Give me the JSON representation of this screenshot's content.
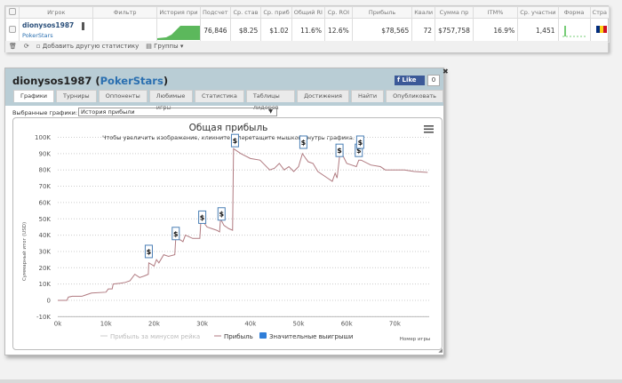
{
  "table": {
    "headers": [
      "Игрок",
      "Фильтр",
      "История при",
      "Подсчет",
      "Ср. став",
      "Ср. приб",
      "Общий RI",
      "Ср. ROI",
      "Прибыль",
      "Квали",
      "Сумма пр",
      "ITM%",
      "Ср. участни",
      "Форма",
      "Стра"
    ],
    "row": {
      "player": "dionysos1987",
      "site": "PokerStars",
      "count": "76,846",
      "avg_stake": "$8.25",
      "avg_profit": "$1.02",
      "total_roi": "11.6%",
      "avg_roi": "12.6%",
      "profit": "$78,565",
      "quali": "72",
      "sum": "$757,758",
      "itm": "16.9%",
      "avg_entrants": "1,451"
    },
    "toolbar": {
      "add_stat": "Добавить другую статистику",
      "groups": "Группы ▾"
    }
  },
  "popup": {
    "player": "dionysos1987",
    "site": "PokerStars",
    "like": "Like",
    "like_count": "0",
    "tabs": [
      "Графики",
      "Турниры",
      "Оппоненты",
      "Любимые игры",
      "Статистика",
      "Таблицы лидеров",
      "Достижения",
      "Найти",
      "Опубликовать"
    ],
    "selected_label": "Выбранные графики:",
    "selected_value": "История прибыли"
  },
  "chart_data": {
    "type": "line",
    "title": "Общая прибыль",
    "subtitle": "Чтобы увеличить изображение, кликните и перетащите мышкой внутрь графика.",
    "xlabel": "Номер игры",
    "ylabel": "Суммарный итог (USD)",
    "xlim": [
      0,
      78
    ],
    "ylim": [
      -10,
      100
    ],
    "xticks": [
      "0k",
      "10k",
      "20k",
      "30k",
      "40k",
      "50k",
      "60k",
      "70k"
    ],
    "yticks": [
      "-10K",
      "0",
      "10K",
      "20K",
      "30K",
      "40K",
      "50K",
      "60K",
      "70K",
      "80K",
      "90K",
      "100K"
    ],
    "legend": [
      "Прибыль за минусом рейка",
      "Прибыль",
      "Значительные выигрыши"
    ],
    "marker_label": "$",
    "series": [
      {
        "name": "Прибыль",
        "x_k": [
          0,
          1.9,
          2.2,
          3,
          5,
          5.5,
          7,
          10,
          10.5,
          11.3,
          11.5,
          13,
          14,
          15,
          16,
          17,
          18,
          18.8,
          18.9,
          19.5,
          20,
          20.5,
          21,
          22,
          23,
          24.3,
          24.5,
          25.5,
          26,
          26.5,
          28,
          29.5,
          29.7,
          30,
          31,
          33,
          33.6,
          33.8,
          34.5,
          35.5,
          36.3,
          36.5,
          38,
          40,
          42,
          43,
          44,
          45,
          46,
          47,
          48,
          49,
          50,
          50.8,
          51.5,
          52,
          53,
          54,
          56,
          57,
          57.6,
          58,
          58.5,
          59,
          60,
          61,
          62,
          62.5,
          63,
          65,
          67,
          68,
          70,
          72,
          74,
          76.8
        ],
        "y_k": [
          0,
          0,
          2,
          2.5,
          2.5,
          3,
          4.5,
          5,
          7,
          7,
          10,
          10.5,
          11,
          12,
          16,
          14,
          15,
          16,
          23,
          22,
          21,
          25,
          23,
          28,
          27,
          28,
          38,
          37,
          36,
          40,
          38,
          38,
          48,
          49,
          45,
          43,
          42,
          50,
          46,
          44,
          43,
          93,
          90,
          87,
          86,
          83,
          80,
          81,
          84,
          80,
          82,
          79,
          82,
          90,
          87,
          85,
          84,
          79,
          75,
          73,
          78,
          75,
          88,
          90,
          84,
          83,
          82,
          86,
          86,
          83,
          82,
          80,
          80,
          80,
          79,
          78.5
        ]
      }
    ],
    "markers": [
      {
        "x_k": 18.9,
        "y_k": 30
      },
      {
        "x_k": 24.5,
        "y_k": 41
      },
      {
        "x_k": 30,
        "y_k": 51
      },
      {
        "x_k": 34,
        "y_k": 53
      },
      {
        "x_k": 36.8,
        "y_k": 98
      },
      {
        "x_k": 51,
        "y_k": 97
      },
      {
        "x_k": 58.5,
        "y_k": 92
      },
      {
        "x_k": 58.8,
        "y_k": 99
      },
      {
        "x_k": 62.5,
        "y_k": 92
      },
      {
        "x_k": 62.8,
        "y_k": 97
      }
    ]
  },
  "colors": {
    "line": "#b07a80",
    "marker": "#4a7fb5",
    "header": "#b9cdd5"
  }
}
